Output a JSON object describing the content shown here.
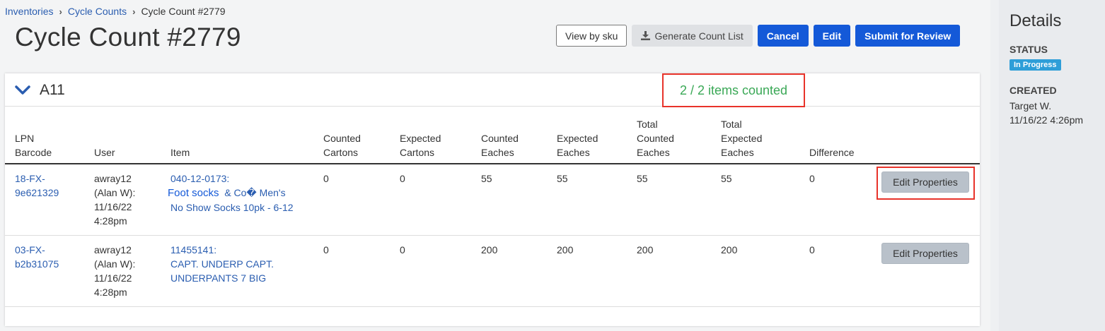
{
  "breadcrumb": {
    "items": [
      "Inventories",
      "Cycle Counts"
    ],
    "current": "Cycle Count #2779"
  },
  "page_title": "Cycle Count #2779",
  "toolbar": {
    "view_by_sku": "View by sku",
    "generate_count_list": "Generate Count List",
    "cancel": "Cancel",
    "edit": "Edit",
    "submit": "Submit for Review"
  },
  "location": {
    "name": "A11",
    "counted_summary": "2 / 2 items counted"
  },
  "table": {
    "headers": {
      "lpn": [
        "LPN",
        "Barcode"
      ],
      "user": "User",
      "item": "Item",
      "counted_cartons": [
        "Counted",
        "Cartons"
      ],
      "expected_cartons": [
        "Expected",
        "Cartons"
      ],
      "counted_eaches": [
        "Counted",
        "Eaches"
      ],
      "expected_eaches": [
        "Expected",
        "Eaches"
      ],
      "total_counted_eaches": [
        "Total",
        "Counted",
        "Eaches"
      ],
      "total_expected_eaches": [
        "Total",
        "Expected",
        "Eaches"
      ],
      "difference": "Difference"
    },
    "rows": [
      {
        "lpn": [
          "18-FX-",
          "9e621329"
        ],
        "user": [
          "awray12",
          "(Alan W):",
          "11/16/22",
          "4:28pm"
        ],
        "item_code": "040-12-0173:",
        "item_link_a": "Foot socks",
        "item_link_b": "& Co� Men's",
        "item_desc": "No Show Socks 10pk - 6-12",
        "counted_cartons": "0",
        "expected_cartons": "0",
        "counted_eaches": "55",
        "expected_eaches": "55",
        "total_counted_eaches": "55",
        "total_expected_eaches": "55",
        "difference": "0",
        "action": "Edit Properties"
      },
      {
        "lpn": [
          "03-FX-",
          "b2b31075"
        ],
        "user": [
          "awray12",
          "(Alan W):",
          "11/16/22",
          "4:28pm"
        ],
        "item_code": "11455141:",
        "item_desc_1": "CAPT. UNDERP CAPT.",
        "item_desc_2": "UNDERPANTS 7 BIG",
        "counted_cartons": "0",
        "expected_cartons": "0",
        "counted_eaches": "200",
        "expected_eaches": "200",
        "total_counted_eaches": "200",
        "total_expected_eaches": "200",
        "difference": "0",
        "action": "Edit Properties"
      }
    ]
  },
  "sidebar": {
    "title": "Details",
    "status_label": "STATUS",
    "status_value": "In Progress",
    "created_label": "CREATED",
    "created_by": "Target W.",
    "created_at": "11/16/22 4:26pm"
  },
  "colors": {
    "primary": "#1459d8",
    "success": "#3aa856",
    "badge": "#2e9ed8",
    "highlight": "#e8332a",
    "link": "#2a5db0"
  }
}
